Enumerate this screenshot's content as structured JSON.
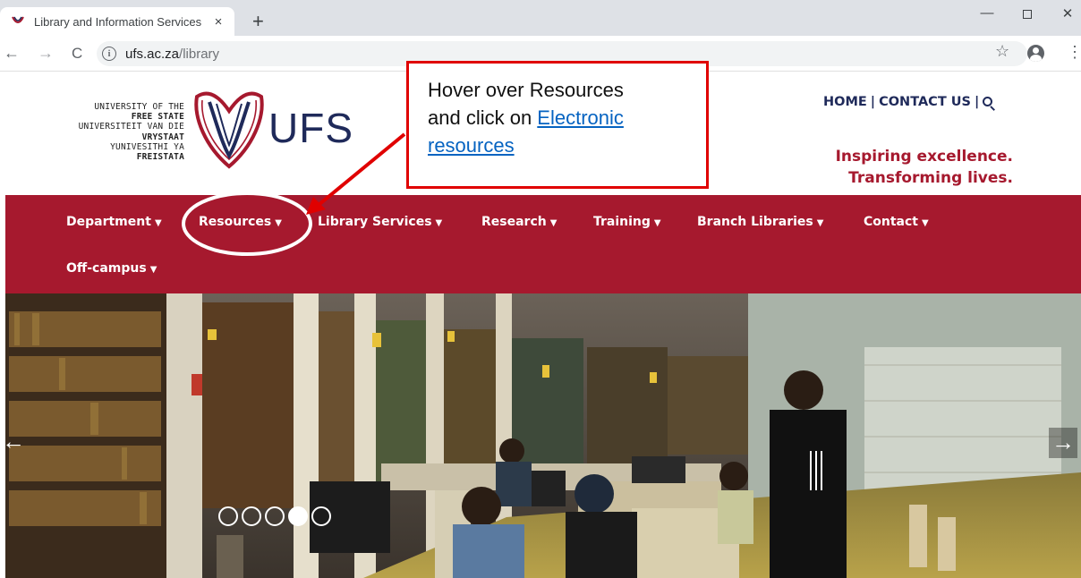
{
  "browser": {
    "tab_title": "Library and Information Services",
    "tab_close": "×",
    "new_tab": "+",
    "url_host": "ufs.ac.za",
    "url_path": "/library",
    "win_minimize": "—",
    "win_close": "✕"
  },
  "header": {
    "logo_lines": [
      {
        "text": "UNIVERSITY OF THE",
        "bold": false
      },
      {
        "text": "FREE STATE",
        "bold": true
      },
      {
        "text": "UNIVERSITEIT VAN DIE",
        "bold": false
      },
      {
        "text": "VRYSTAAT",
        "bold": true
      },
      {
        "text": "YUNIVESITHI YA",
        "bold": false
      },
      {
        "text": "FREISTATA",
        "bold": true
      }
    ],
    "logo_wordmark": "UFS",
    "links": [
      "HOME",
      "CONTACT US"
    ],
    "separator": "|",
    "tagline_1": "Inspiring excellence.",
    "tagline_2": "Transforming lives."
  },
  "nav": {
    "items": [
      {
        "label": "Department"
      },
      {
        "label": "Resources"
      },
      {
        "label": "Library Services"
      },
      {
        "label": "Research"
      },
      {
        "label": "Training"
      },
      {
        "label": "Branch Libraries"
      },
      {
        "label": "Contact"
      },
      {
        "label": "Off-campus"
      }
    ],
    "caret": "▼"
  },
  "carousel": {
    "slide_count": 5,
    "active_slide": 4,
    "prev_arrow": "←",
    "next_arrow": "→"
  },
  "annotation": {
    "line_1": "Hover over Resources",
    "line_2_prefix": "and click on ",
    "link_1": "Electronic",
    "link_2": "resources",
    "color": "#e00000"
  },
  "colors": {
    "brand_red": "#a6192e",
    "brand_navy": "#1f2a5a"
  }
}
